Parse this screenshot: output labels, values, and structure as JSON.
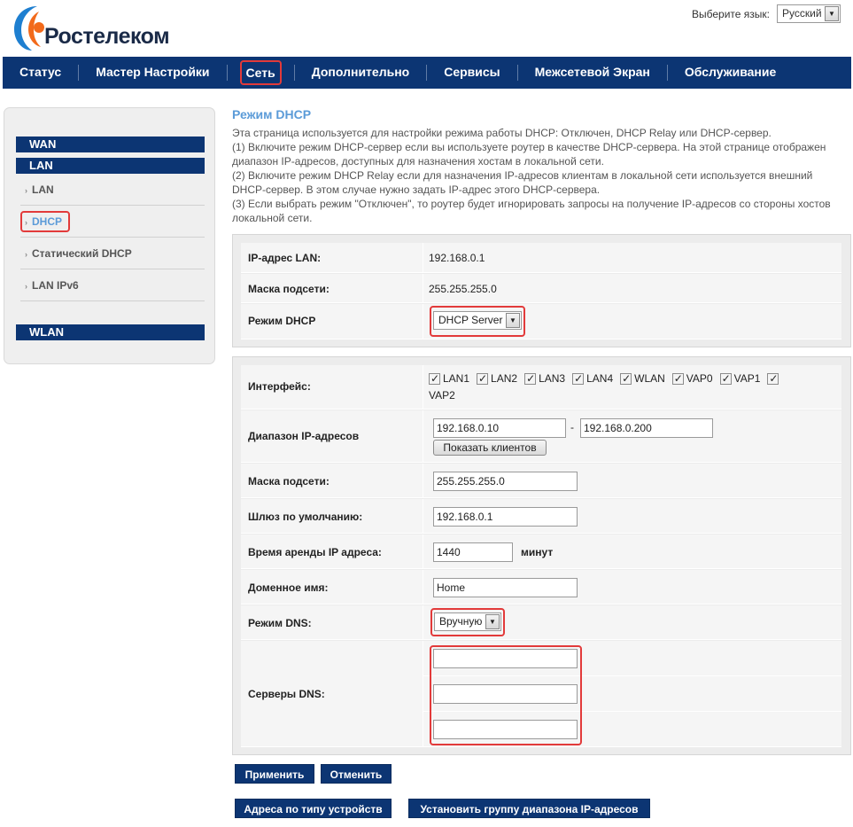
{
  "header": {
    "brand": "Ростелеком",
    "lang_label": "Выберите язык:",
    "lang_value": "Русский"
  },
  "nav": {
    "items": [
      "Статус",
      "Мастер Настройки",
      "Сеть",
      "Дополнительно",
      "Сервисы",
      "Межсетевой Экран",
      "Обслуживание"
    ],
    "active": "Сеть"
  },
  "sidebar": {
    "wan": "WAN",
    "lan": "LAN",
    "items": [
      "LAN",
      "DHCP",
      "Статический DHCP",
      "LAN IPv6"
    ],
    "active": "DHCP",
    "wlan": "WLAN"
  },
  "page": {
    "title": "Режим DHCP",
    "desc": [
      "Эта страница используется для настройки режима работы DHCP: Отключен, DHCP Relay или DHCP-сервер.",
      "(1) Включите режим DHCP-сервер если вы используете роутер в качестве DHCP-сервера. На этой странице отображен диапазон IP-адресов, доступных для назначения хостам в локальной сети.",
      "(2) Включите режим DHCP Relay если для назначения IP-адресов клиентам в локальной сети используется внешний DHCP-сервер. В этом случае нужно задать IP-адрес этого DHCP-сервера.",
      "(3) Если выбрать режим \"Отключен\", то роутер будет игнорировать запросы на получение IP-адресов со стороны хостов локальной сети."
    ]
  },
  "lan_info": {
    "ip_label": "IP-адрес LAN:",
    "ip_value": "192.168.0.1",
    "mask_label": "Маска подсети:",
    "mask_value": "255.255.255.0",
    "mode_label": "Режим DHCP",
    "mode_value": "DHCP Server"
  },
  "dhcp": {
    "iface_label": "Интерфейс:",
    "interfaces": [
      "LAN1",
      "LAN2",
      "LAN3",
      "LAN4",
      "WLAN",
      "VAP0",
      "VAP1",
      "VAP2"
    ],
    "range_label": "Диапазон IP-адресов",
    "range_start": "192.168.0.10",
    "range_sep": "-",
    "range_end": "192.168.0.200",
    "show_clients": "Показать клиентов",
    "mask_label": "Маска подсети:",
    "mask_value": "255.255.255.0",
    "gw_label": "Шлюз по умолчанию:",
    "gw_value": "192.168.0.1",
    "lease_label": "Время аренды IP адреса:",
    "lease_value": "1440",
    "lease_unit": "минут",
    "domain_label": "Доменное имя:",
    "domain_value": "Home",
    "dns_mode_label": "Режим DNS:",
    "dns_mode_value": "Вручную",
    "dns_servers_label": "Серверы DNS:",
    "dns_servers": [
      "",
      "",
      ""
    ]
  },
  "buttons": {
    "apply": "Применить",
    "cancel": "Отменить",
    "by_device": "Адреса по типу устройств",
    "set_group": "Установить группу диапазона IP-адресов"
  },
  "colors": {
    "nav_bg": "#0c3573",
    "title_blue": "#5b9bd8",
    "highlight_red": "#e23a3a"
  }
}
